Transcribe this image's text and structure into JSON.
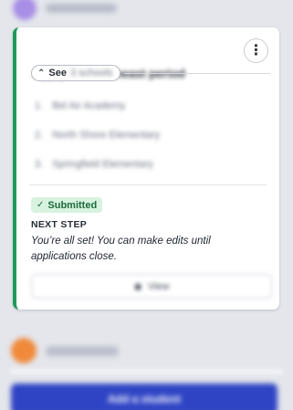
{
  "top_profile": {
    "name": "Jordan Lee"
  },
  "card": {
    "title": "Apply for Southeast period",
    "menu_icon": "more-vertical-icon",
    "see_toggle": {
      "label": "See",
      "rest": "3 schools",
      "icon": "chevron-up-icon"
    },
    "schools": [
      {
        "num": "1.",
        "name": "Bel Air Academy"
      },
      {
        "num": "2.",
        "name": "North Shore Elementary"
      },
      {
        "num": "3.",
        "name": "Springfield Elementary"
      }
    ],
    "status_badge": {
      "label": "Submitted",
      "icon": "check-icon",
      "color": "#1d6a3b",
      "bg": "#d7f3df"
    },
    "next_step_label": "NEXT STEP",
    "next_step_text": "You’re all set! You can make edits until applications close.",
    "view_button": {
      "label": "View",
      "icon": "eye-icon"
    },
    "accent_color": "#1f9a5a"
  },
  "second_profile": {
    "name": "Sam Rivera"
  },
  "bottom_button": {
    "label": "Add a student"
  },
  "colors": {
    "primary": "#2f44c4",
    "orange_avatar": "#f08a3a",
    "purple_avatar": "#a88ee6"
  }
}
